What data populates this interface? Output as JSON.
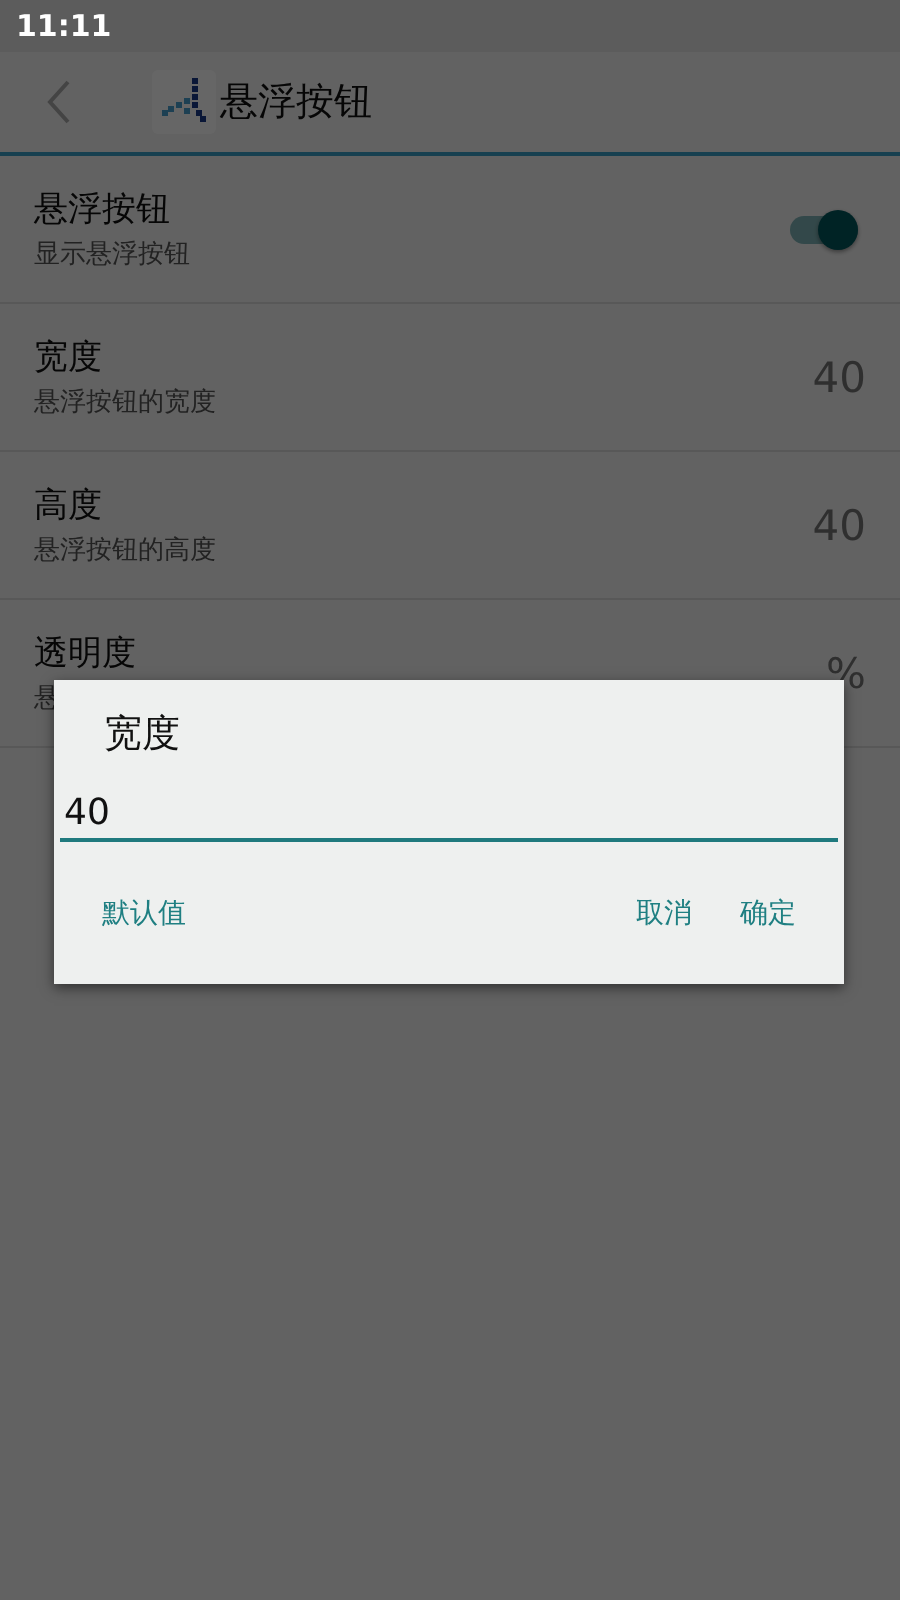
{
  "status_bar": {
    "time": "11:11"
  },
  "toolbar": {
    "title": "悬浮按钮"
  },
  "settings": [
    {
      "kind": "switch",
      "title": "悬浮按钮",
      "subtitle": "显示悬浮按钮",
      "on": true
    },
    {
      "kind": "value",
      "title": "宽度",
      "subtitle": "悬浮按钮的宽度",
      "value": "40"
    },
    {
      "kind": "value",
      "title": "高度",
      "subtitle": "悬浮按钮的高度",
      "value": "40"
    },
    {
      "kind": "value",
      "title": "透明度",
      "subtitle": "悬",
      "value": "%"
    }
  ],
  "dialog": {
    "title": "宽度",
    "value": "40",
    "buttons": [
      {
        "label": "默认值"
      },
      {
        "label": "取消"
      },
      {
        "label": "确定"
      }
    ]
  }
}
